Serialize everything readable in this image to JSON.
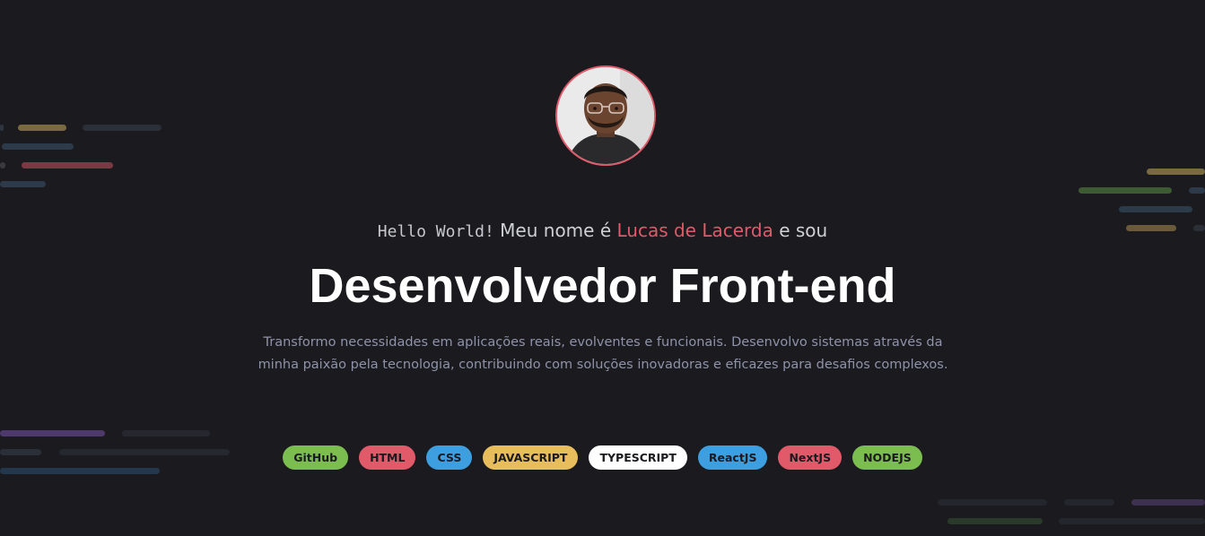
{
  "profile": {
    "greeting_mono": "Hello World!",
    "greeting_text": " Meu nome é ",
    "name": "Lucas de Lacerda",
    "greeting_suffix": " e sou",
    "headline": "Desenvolvedor Front-end",
    "description": "Transformo necessidades em aplicações reais, evolventes e funcionais. Desenvolvo sistemas através da minha paixão pela tecnologia, contribuindo com soluções inovadoras e eficazes para desafios complexos."
  },
  "tags": [
    {
      "label": "GitHub",
      "color": "#7cbd4f"
    },
    {
      "label": "HTML",
      "color": "#e05a6a"
    },
    {
      "label": "CSS",
      "color": "#3d9ee0"
    },
    {
      "label": "JAVASCRIPT",
      "color": "#e8bd5c"
    },
    {
      "label": "TYPESCRIPT",
      "color": "#ffffff"
    },
    {
      "label": "ReactJS",
      "color": "#3d9ee0"
    },
    {
      "label": "NextJS",
      "color": "#e05a6a"
    },
    {
      "label": "NODEJS",
      "color": "#7cbd4f"
    }
  ],
  "colors": {
    "background": "#1a1a1f",
    "accent": "#e05a6a"
  }
}
